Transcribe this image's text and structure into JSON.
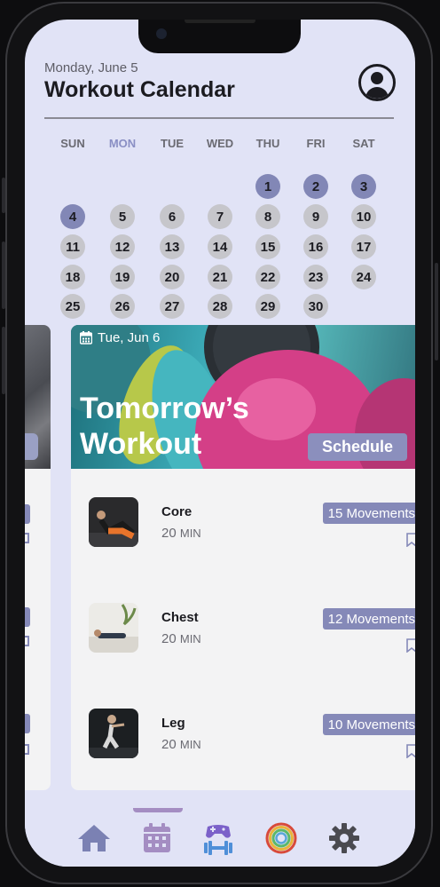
{
  "header": {
    "date": "Monday, June 5",
    "title": "Workout Calendar"
  },
  "calendar": {
    "weekdays": [
      "SUN",
      "MON",
      "TUE",
      "WED",
      "THU",
      "FRI",
      "SAT"
    ],
    "active_weekday": "MON",
    "days": [
      "1",
      "2",
      "3",
      "4",
      "5",
      "6",
      "7",
      "8",
      "9",
      "10",
      "11",
      "12",
      "13",
      "14",
      "15",
      "16",
      "17",
      "18",
      "19",
      "20",
      "21",
      "22",
      "23",
      "24",
      "25",
      "26",
      "27",
      "28",
      "29",
      "30"
    ],
    "highlighted_days": [
      "1",
      "2",
      "3",
      "4"
    ]
  },
  "card": {
    "date": "Tue, Jun 6",
    "title_line1": "Tomorrow’s",
    "title_line2": "Workout",
    "schedule_label": "Schedule",
    "workouts": [
      {
        "name": "Core",
        "duration": "20",
        "unit": "MIN",
        "movements": "15 Movements"
      },
      {
        "name": "Chest",
        "duration": "20",
        "unit": "MIN",
        "movements": "12 Movements"
      },
      {
        "name": "Leg",
        "duration": "20",
        "unit": "MIN",
        "movements": "10 Movements"
      }
    ]
  },
  "tabbar": {
    "items": [
      "home-icon",
      "calendar-icon",
      "gamepad-dumbbell-icon",
      "activity-ring-icon",
      "settings-gear-icon"
    ],
    "active": "calendar-icon"
  },
  "colors": {
    "accent": "#8589b8",
    "background": "#e1e3f6",
    "card": "#f3f3f4",
    "day_default": "#c6c6cb"
  }
}
